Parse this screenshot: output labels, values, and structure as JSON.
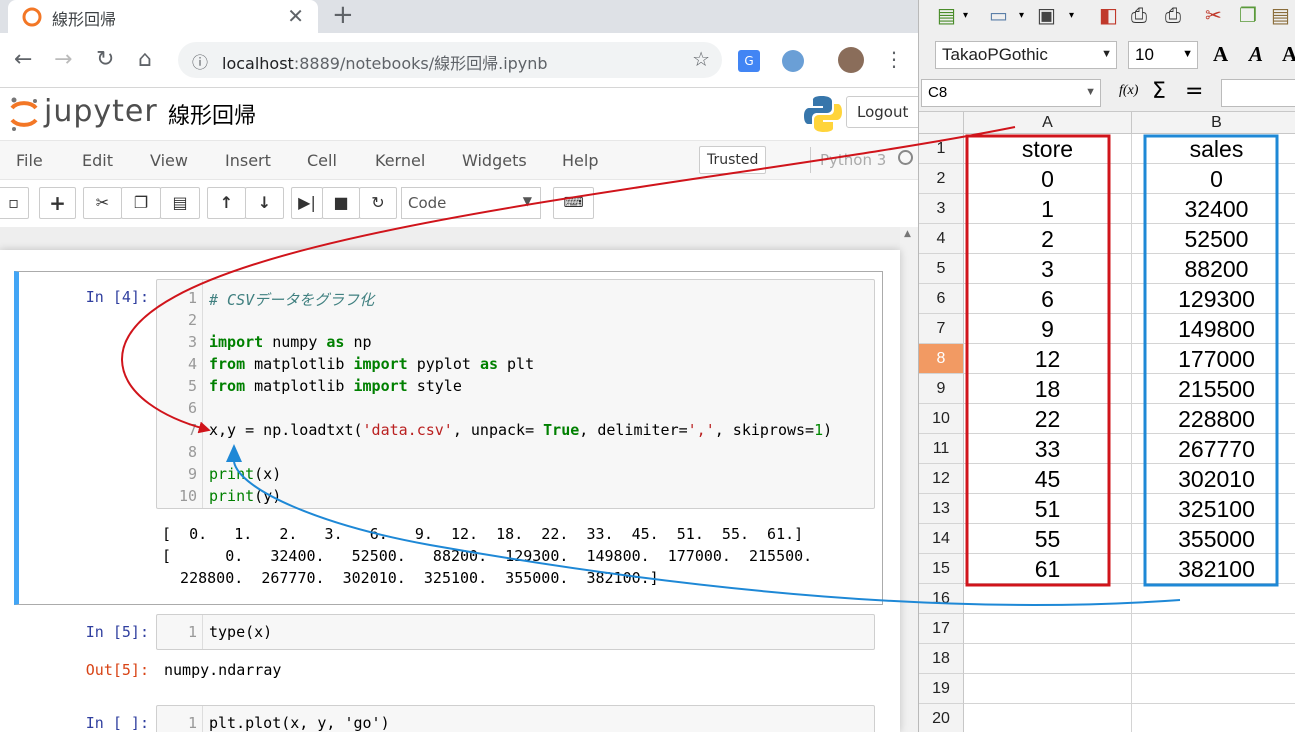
{
  "browser": {
    "tab_title": "線形回帰",
    "url_host": "localhost",
    "url_path": ":8889/notebooks/線形回帰.ipynb"
  },
  "jupyter": {
    "logo_text": "jupyter",
    "notebook_title": "線形回帰",
    "logout_label": "Logout",
    "menu": [
      "File",
      "Edit",
      "View",
      "Insert",
      "Cell",
      "Kernel",
      "Widgets",
      "Help"
    ],
    "trusted_label": "Trusted",
    "kernel_name": "Python 3",
    "cell_type": "Code"
  },
  "cells": {
    "cell1": {
      "prompt": "In [4]:",
      "lines": [
        "# CSVデータをグラフ化",
        "",
        "import numpy as np",
        "from matplotlib import pyplot as plt",
        "from matplotlib import style",
        "",
        "x,y = np.loadtxt('data.csv', unpack= True, delimiter=',', skiprows=1)",
        "",
        "print(x)",
        "print(y)"
      ],
      "output": [
        "[  0.   1.   2.   3.   6.   9.  12.  18.  22.  33.  45.  51.  55.  61.]",
        "[      0.   32400.   52500.   88200.  129300.  149800.  177000.  215500.",
        "  228800.  267770.  302010.  325100.  355000.  382100.]"
      ]
    },
    "cell2": {
      "prompt": "In [5]:",
      "code": "type(x)",
      "out_prompt": "Out[5]:",
      "output": "numpy.ndarray"
    },
    "cell3": {
      "prompt": "In [ ]:",
      "code": "plt.plot(x, y, 'go')"
    }
  },
  "spreadsheet": {
    "font_name": "TakaoPGothic",
    "font_size": "10",
    "name_box": "C8",
    "columns": [
      "A",
      "B"
    ],
    "rows": [
      [
        "store",
        "sales"
      ],
      [
        "0",
        "0"
      ],
      [
        "1",
        "32400"
      ],
      [
        "2",
        "52500"
      ],
      [
        "3",
        "88200"
      ],
      [
        "6",
        "129300"
      ],
      [
        "9",
        "149800"
      ],
      [
        "12",
        "177000"
      ],
      [
        "18",
        "215500"
      ],
      [
        "22",
        "228800"
      ],
      [
        "33",
        "267770"
      ],
      [
        "45",
        "302010"
      ],
      [
        "51",
        "325100"
      ],
      [
        "55",
        "355000"
      ],
      [
        "61",
        "382100"
      ],
      [
        "",
        ""
      ],
      [
        "",
        ""
      ],
      [
        "",
        ""
      ],
      [
        "",
        ""
      ],
      [
        "",
        ""
      ]
    ],
    "row_numbers": [
      "1",
      "2",
      "3",
      "4",
      "5",
      "6",
      "7",
      "8",
      "9",
      "10",
      "11",
      "12",
      "13",
      "14",
      "15",
      "16",
      "17",
      "18",
      "19",
      "20"
    ],
    "active_row": "8"
  },
  "colors": {
    "annotation_red": "#d0141b",
    "annotation_blue": "#1e88d6",
    "active_row_header": "#f29a63",
    "selected_cell_bar": "#42a5f5"
  }
}
